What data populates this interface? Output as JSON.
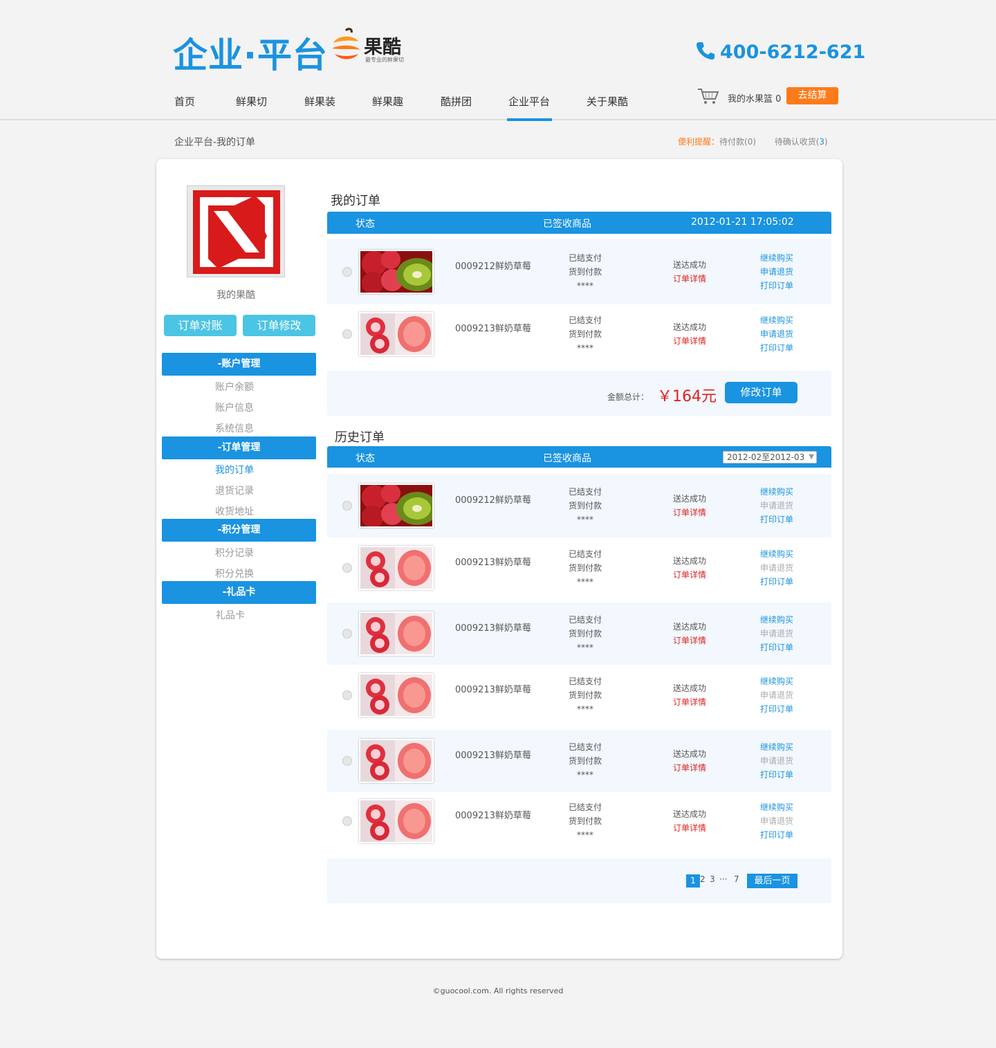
{
  "header": {
    "platform_logo": "企业",
    "platform_logo_dot": "·",
    "platform_logo_2": "平台",
    "brand_name": "果酷",
    "brand_slogan": "最专业的鲜果切",
    "phone": "400-6212-621"
  },
  "nav": {
    "items": [
      "首页",
      "鲜果切",
      "鲜果装",
      "鲜果趣",
      "酷拼团",
      "企业平台",
      "关于果酷"
    ],
    "active": "企业平台"
  },
  "cart": {
    "label": "我的水果篮",
    "count": "0",
    "checkout_label": "去结算"
  },
  "breadcrumb": "企业平台-我的订单",
  "reminder": {
    "label": "便利提醒：",
    "pending_payment": "待付款(0)",
    "pending_receipt_prefix": "待确认收货(",
    "pending_receipt_count": "3",
    "pending_receipt_suffix": ")"
  },
  "sidebar": {
    "user_name": "我的果酷",
    "btn_reconcile": "订单对账",
    "btn_modify": "订单修改",
    "groups": [
      {
        "title": "-账户管理",
        "items": [
          "账户余额",
          "账户信息",
          "系统信息"
        ]
      },
      {
        "title": "-订单管理",
        "items": [
          "我的订单",
          "退货记录",
          "收货地址"
        ]
      },
      {
        "title": "-积分管理",
        "items": [
          "积分记录",
          "积分兑换"
        ]
      },
      {
        "title": "-礼品卡",
        "items": [
          "礼品卡"
        ]
      }
    ],
    "active_item": "我的订单"
  },
  "my_orders": {
    "title": "我的订单",
    "head": {
      "status": "状态",
      "signed": "已签收商品",
      "datetime": "2012-01-21  17:05:02"
    },
    "rows": [
      {
        "code": "0009212鲜奶草莓",
        "pay1": "已结支付",
        "pay2": "货到付款",
        "pay3": "****",
        "ship": "送达成功",
        "detail": "订单详情",
        "a1": "继续购买",
        "a2": "申请退货",
        "a3": "打印订单",
        "img": "strawberry-kiwi"
      },
      {
        "code": "0009213鲜奶草莓",
        "pay1": "已结支付",
        "pay2": "货到付款",
        "pay3": "****",
        "ship": "送达成功",
        "detail": "订单详情",
        "a1": "继续购买",
        "a2": "申请退货",
        "a3": "打印订单",
        "img": "strawberry-grapefruit"
      }
    ],
    "total_label": "金额总计：",
    "total_amount": "￥164元",
    "modify_btn": "修改订单"
  },
  "history": {
    "title": "历史订单",
    "head": {
      "status": "状态",
      "signed": "已签收商品",
      "range": "2012-02至2012-03"
    },
    "rows": [
      {
        "code": "0009212鲜奶草莓",
        "pay1": "已结支付",
        "pay2": "货到付款",
        "pay3": "****",
        "ship": "送达成功",
        "detail": "订单详情",
        "a1": "继续购买",
        "a2": "申请退货",
        "a3": "打印订单",
        "img": "strawberry-kiwi"
      },
      {
        "code": "0009213鲜奶草莓",
        "pay1": "已结支付",
        "pay2": "货到付款",
        "pay3": "****",
        "ship": "送达成功",
        "detail": "订单详情",
        "a1": "继续购买",
        "a2": "申请退货",
        "a3": "打印订单",
        "img": "strawberry-grapefruit"
      },
      {
        "code": "0009213鲜奶草莓",
        "pay1": "已结支付",
        "pay2": "货到付款",
        "pay3": "****",
        "ship": "送达成功",
        "detail": "订单详情",
        "a1": "继续购买",
        "a2": "申请退货",
        "a3": "打印订单",
        "img": "strawberry-grapefruit"
      },
      {
        "code": "0009213鲜奶草莓",
        "pay1": "已结支付",
        "pay2": "货到付款",
        "pay3": "****",
        "ship": "送达成功",
        "detail": "订单详情",
        "a1": "继续购买",
        "a2": "申请退货",
        "a3": "打印订单",
        "img": "strawberry-grapefruit"
      },
      {
        "code": "0009213鲜奶草莓",
        "pay1": "已结支付",
        "pay2": "货到付款",
        "pay3": "****",
        "ship": "送达成功",
        "detail": "订单详情",
        "a1": "继续购买",
        "a2": "申请退货",
        "a3": "打印订单",
        "img": "strawberry-grapefruit"
      },
      {
        "code": "0009213鲜奶草莓",
        "pay1": "已结支付",
        "pay2": "货到付款",
        "pay3": "****",
        "ship": "送达成功",
        "detail": "订单详情",
        "a1": "继续购买",
        "a2": "申请退货",
        "a3": "打印订单",
        "img": "strawberry-grapefruit"
      }
    ]
  },
  "pager": {
    "current": "1",
    "p2": "2",
    "p3": "3",
    "ellipsis": "···",
    "p7": "7",
    "last_label": "最后一页"
  },
  "footer": "©guocool.com. All rights reserved",
  "colors": {
    "primary": "#1a93e0",
    "accent": "#ff7a1a",
    "danger": "#e02020",
    "aqua": "#4cc4e4"
  }
}
